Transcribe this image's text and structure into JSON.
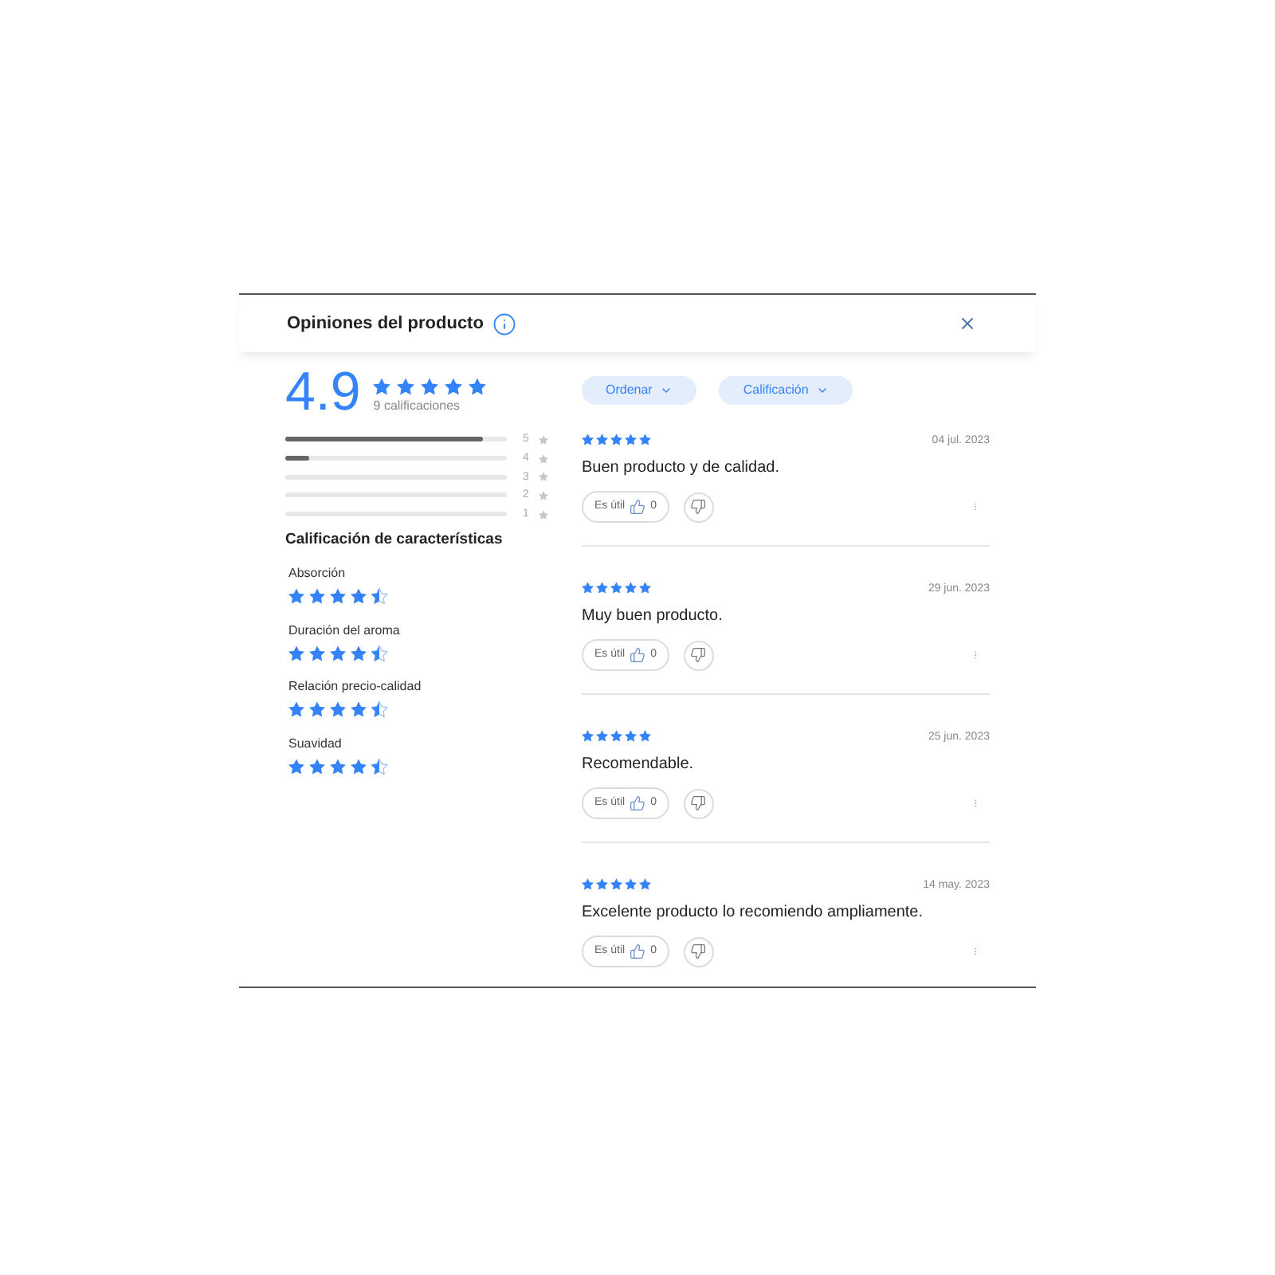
{
  "header": {
    "title": "Opiniones del producto"
  },
  "summary": {
    "score": "4.9",
    "stars": 5,
    "count": "9 calificaciones"
  },
  "distribution": [
    {
      "label": "5",
      "level": 0.89
    },
    {
      "label": "4",
      "level": 0.11
    },
    {
      "label": "3"
    },
    {
      "label": "2"
    },
    {
      "label": "1"
    }
  ],
  "features": {
    "title": "Calificación de características",
    "items": [
      {
        "name": "Absorción",
        "stars": 4.5
      },
      {
        "name": "Duración del aroma",
        "stars": 4.5
      },
      {
        "name": "Relación precio-calidad",
        "stars": 4.5
      },
      {
        "name": "Suavidad",
        "stars": 4.5
      }
    ]
  },
  "filters": [
    {
      "label": "Ordenar"
    },
    {
      "label": "Calificación"
    }
  ],
  "reviews": [
    {
      "stars": 5,
      "date": "04 jul. 2023",
      "text": "Buen producto y de calidad.",
      "helpful_label": "Es útil",
      "likes": "0"
    },
    {
      "stars": 5,
      "date": "29 jun. 2023",
      "text": "Muy buen producto.",
      "helpful_label": "Es útil",
      "likes": "0"
    },
    {
      "stars": 5,
      "date": "25 jun. 2023",
      "text": "Recomendable.",
      "helpful_label": "Es útil",
      "likes": "0"
    },
    {
      "stars": 5,
      "date": "14 may. 2023",
      "text": "Excelente producto lo recomiendo ampliamente.",
      "helpful_label": "Es útil",
      "likes": "0"
    }
  ]
}
